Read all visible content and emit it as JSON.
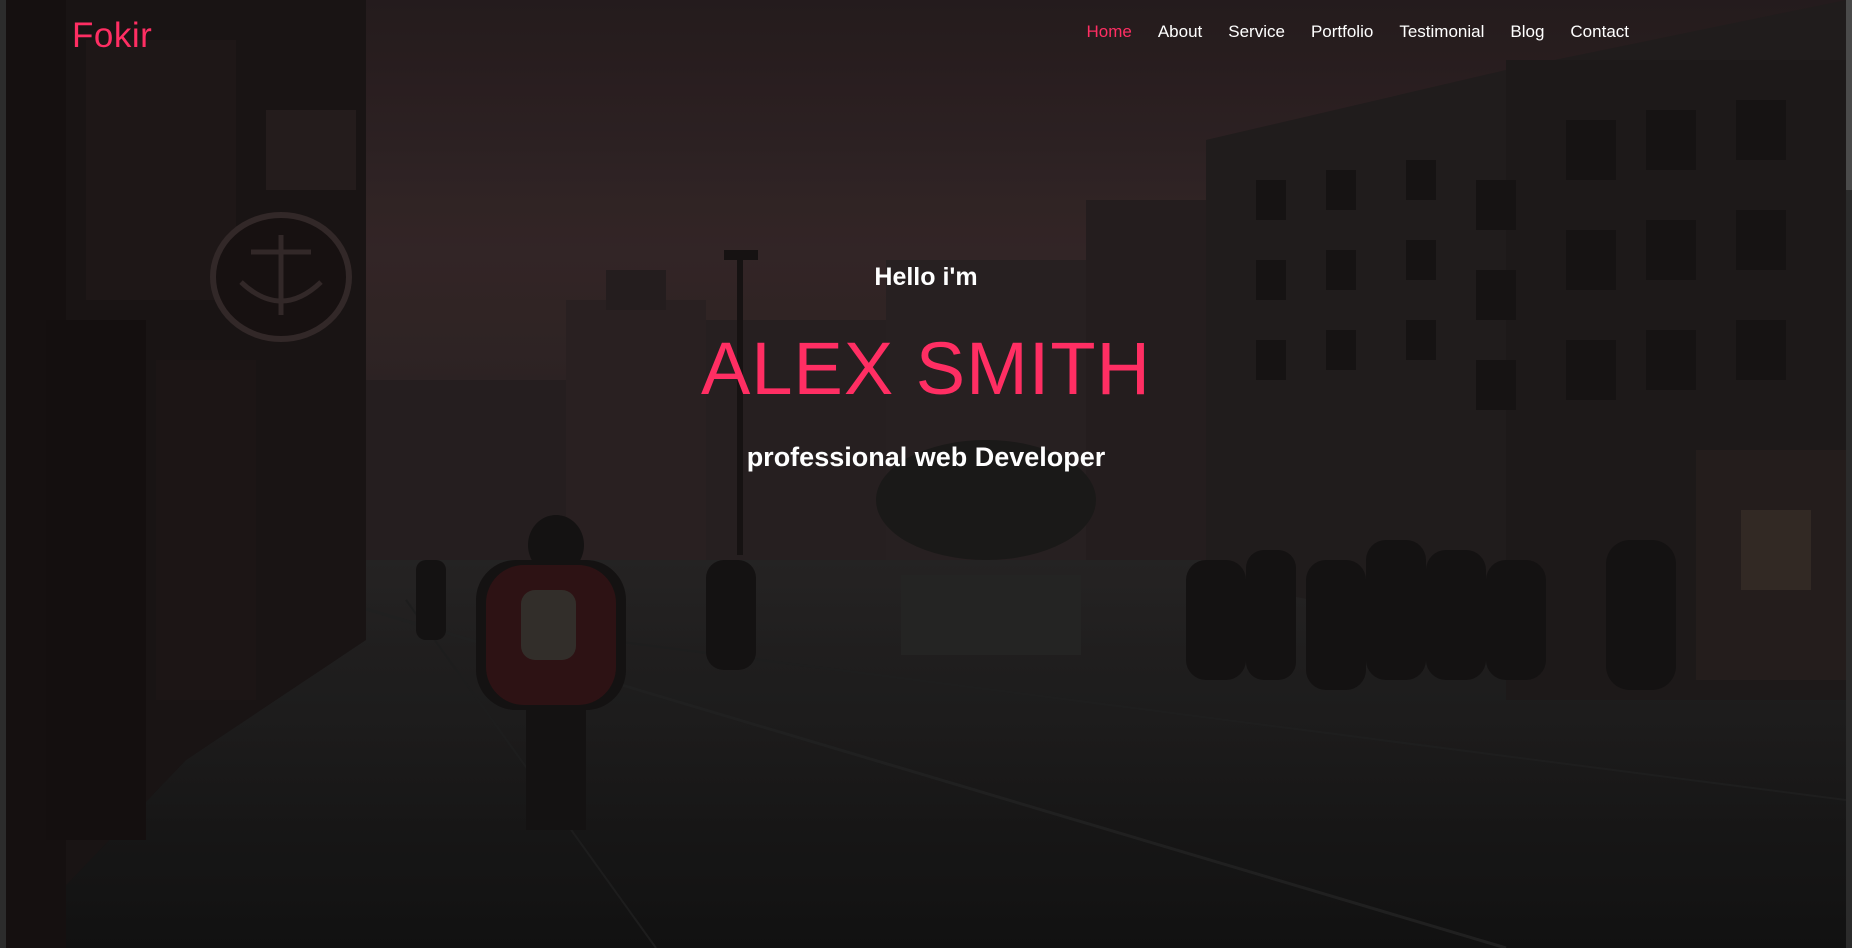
{
  "brand": {
    "logo": "Fokir",
    "accent_color": "#ff2e63"
  },
  "nav": {
    "items": [
      {
        "label": "Home",
        "active": true
      },
      {
        "label": "About",
        "active": false
      },
      {
        "label": "Service",
        "active": false
      },
      {
        "label": "Portfolio",
        "active": false
      },
      {
        "label": "Testimonial",
        "active": false
      },
      {
        "label": "Blog",
        "active": false
      },
      {
        "label": "Contact",
        "active": false
      }
    ]
  },
  "hero": {
    "greeting": "Hello i'm",
    "name": "ALEX SMITH",
    "role": "professional web Developer",
    "background": "darkened-city-street-photo"
  }
}
